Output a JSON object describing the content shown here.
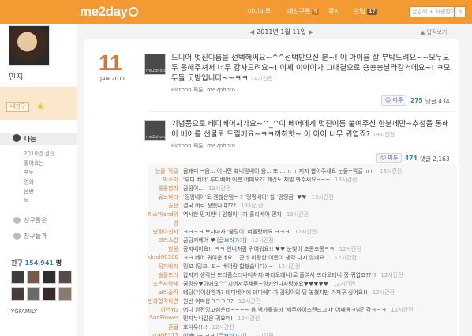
{
  "header": {
    "logo": "me2day",
    "nav": [
      {
        "label": "마이미투",
        "count": ""
      },
      {
        "label": "내친구들",
        "count": "5"
      },
      {
        "label": "쪽지",
        "count": ""
      },
      {
        "label": "알림",
        "count": "47"
      }
    ],
    "search_placeholder": "글검색 + 사람찾기",
    "search_icon": "search-icon",
    "bg_color": "#f39a33"
  },
  "sidebar": {
    "username": "민지",
    "friend_button": "내친구",
    "me_label": "나는",
    "sub_items": [
      "2010년 결산",
      "좋아요는",
      "포토",
      "영화",
      "음반",
      "책"
    ],
    "links": [
      "친구들은",
      "친구들과"
    ],
    "friends_prefix": "친구",
    "friends_count": "154,941",
    "friends_suffix": "명",
    "friend_name": "YGFAMILY"
  },
  "main": {
    "date_label": "2011년 1월 11일",
    "fold_label": "▲ 답적보기",
    "day": "11",
    "month_year": "JAN 2011",
    "posts": [
      {
        "thumb_label": "me2photo",
        "text": "드디어 멋진이름을 선택해써요~^^선택받으신 분~! 이 아이를 잘 부탁드려요~~모두모두 응해주셔서 너무 감사드려요~! 이제 이아이가 그대곁으로 숑숑숑날라갈거에요~! ㅋ모두들 굿밤입니다~~ㅋㅋ",
        "time": "14시간전",
        "meta_source": "Pictoon 픽툰",
        "meta_app": "me2photo",
        "metoo_label": "미투",
        "metoo_count": "275",
        "comment_label": "댓글 434"
      },
      {
        "thumb_label": "me2photo",
        "text": "기념품으로 테디베어사가요~^_^이 베어에게 멋진이름 붙여주신 한분께만~추첨을 통해 이 베어를 선물로 드릴께요~ㅋㅋ까하핫~ 이 아이 너무 귀엽죠?",
        "time": "19시간전",
        "meta_source": "Pictoon 픽툰",
        "meta_app": "me2photo",
        "metoo_label": "미투",
        "metoo_count": "474",
        "comment_label": "댓글 2,163"
      }
    ],
    "comments": [
      {
        "who": "눈물_막귤",
        "msg": "꿈돼디 ~음... 어니면 훼니맘베어 음... 또.... ㅠㅠ 저저 뽑아주세요 눈물~막귤 ㅠㅠ",
        "time": "13시간전"
      },
      {
        "who": "박소미",
        "msg": "'루디 베어' 루디베어 이름 어때요?? 제것도 제발 봐주세요~~~",
        "time": "13시간전"
      },
      {
        "who": "롤롤할라",
        "msg": "꿈꿈이...",
        "time": "13시간전"
      },
      {
        "who": "유보하라",
        "msg": "'띵띵베어'도 괜찮은뎅~ ? '띵띵베어' 할 '띵띵곰' ♥♥",
        "time": "13시간전"
      },
      {
        "who": "출전",
        "msg": "결국 어로 정했나여???",
        "time": "13시간전"
      },
      {
        "who": "카리스마and위",
        "msg": "역시한 민지언니 인형이니까 홀리베아 민지",
        "time": "13시간전"
      },
      {
        "who": "영",
        "msg": "",
        "time": ""
      },
      {
        "who": "난팅이신사",
        "msg": "ㅋㅋㅋㅋ 보자마자 '꿈딩이' 떠올랐어요 ㅋㅋㅋ",
        "time": "12시간전"
      },
      {
        "who": "코리스칼",
        "msg": "꿈딩키베어 ♥ ",
        "link": "[글보러가기]",
        "time": "12시간전"
      },
      {
        "who": "밤몽",
        "msg": "꽁지베어요!! ㅋㅋ 언니처럼 귀여워요!! ♥♥ 눈빛이 초롱초롱ㅋㅋ",
        "time": "12시간전"
      },
      {
        "who": "dmd00100",
        "msg": "ㅋㅋ 베어 귀여운데요... 근데 이랑한 이름이 생각 나지 않네요...",
        "time": "12시간전"
      },
      {
        "who": "꿈지바리",
        "msg": "밍꼬 (밍크, 꼬~ 베어랑 합쳤습니다) ~",
        "time": "12시간전"
      },
      {
        "who": "솔플뜨라",
        "msg": "갑자기 생각난 뜨라폼스터나디처지(파라오태니)로 줄여서 뜨라오테니 정 귀엽죠??!!",
        "time": "12시간전"
      },
      {
        "who": "조은사랑새",
        "msg": "꿈밍순♥이에요^^지어저주세욤~밍키언니사랑해요♥♥♥♥♥",
        "time": "12시간전"
      },
      {
        "who": "보라술직",
        "msg": "테딩(?)이상한가? 테디베어에 테디에다가 꿈팅이의 딩 놓쳤지만 가져구 싶어요!!",
        "time": "12시간전"
      },
      {
        "who": "원빈과합격하면",
        "msg": "원빈 어떠용ㅋㅋㅋㅋ?",
        "time": "12시간전"
      },
      {
        "who": "하얀YG",
        "msg": "어니 완전잉고심은데~~~~ 음 백가좋을까 '제주아이스랜드고마' 어때용ㅋ넘긴각ㅋㅋㅋ",
        "time": "12시간전"
      },
      {
        "who": "SunFlower",
        "msg": "민지누나같은 귀요미!",
        "time": "12시간전"
      },
      {
        "who": "흔글",
        "msg": "호디우!!!!",
        "time": "12시간전"
      },
      {
        "who": "ska06113",
        "msg": "이쁜다~ ㅋㅋ ",
        "link": "[글보러가기]",
        "time": "12시간전"
      }
    ]
  },
  "colors": {
    "brand": "#f39a33",
    "date": "#d7753a",
    "link": "#3a7fc1"
  }
}
